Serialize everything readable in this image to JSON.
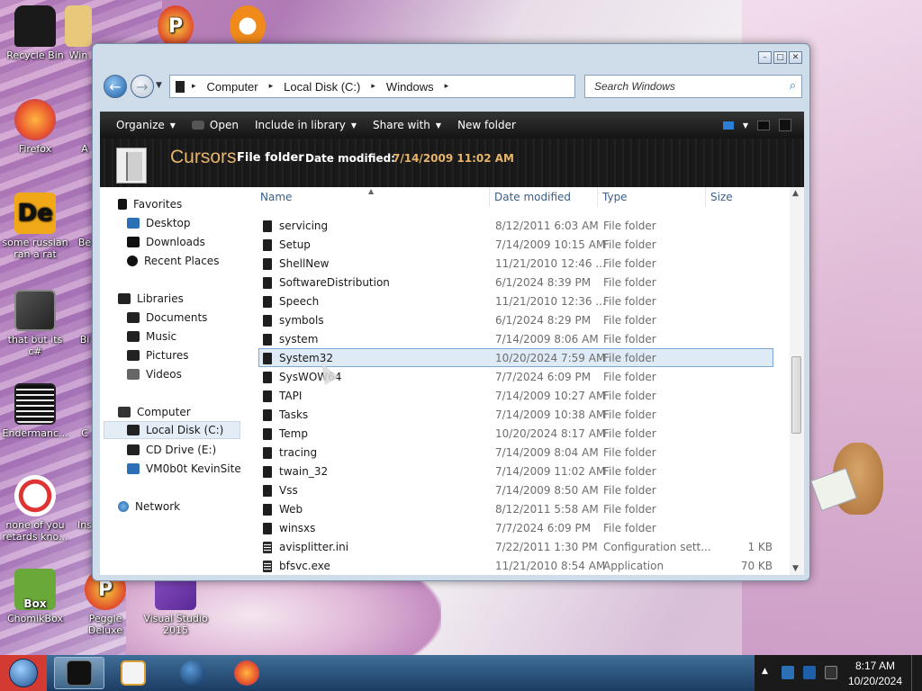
{
  "colors": {
    "toolbar_bg": "#1a1a1a",
    "details_accent": "#e8b46a",
    "selection_bg": "#dfeaf7",
    "start_button": "#d23a32"
  },
  "desktop": {
    "icons": [
      {
        "label": "Recycle Bin",
        "icon": "recycle-bin-icon"
      },
      {
        "label": "Win",
        "icon": "folder-icon"
      },
      {
        "label": "Firefox",
        "icon": "firefox-icon"
      },
      {
        "label": "A",
        "icon": "app-icon"
      },
      {
        "label": "some russian ran a rat",
        "icon": "de-app-icon"
      },
      {
        "label": "Be",
        "icon": "app-icon"
      },
      {
        "label": "that but its c#",
        "icon": "copy-icon"
      },
      {
        "label": "Bi",
        "icon": "app-icon"
      },
      {
        "label": "Endermanc...",
        "icon": "terminal-icon"
      },
      {
        "label": "C",
        "icon": "app-icon"
      },
      {
        "label": "none of you retards kno...",
        "icon": "dragon-icon"
      },
      {
        "label": "Ins",
        "icon": "app-icon"
      },
      {
        "label": "ChomikBox",
        "icon": "chomikbox-icon"
      },
      {
        "label": "Peggle Deluxe",
        "icon": "peggle-icon"
      },
      {
        "label": "Visual Studio 2015",
        "icon": "visual-studio-icon"
      }
    ]
  },
  "window": {
    "nav": {
      "back_icon": "back-arrow-icon",
      "forward_icon": "forward-arrow-icon"
    },
    "breadcrumb": [
      "Computer",
      "Local Disk (C:)",
      "Windows"
    ],
    "search_placeholder": "Search Windows",
    "toolbar": {
      "organize": "Organize",
      "open": "Open",
      "include_in_library": "Include in library",
      "share_with": "Share with",
      "new_folder": "New folder"
    },
    "details": {
      "name": "Cursors",
      "type": "File folder",
      "modified_label": "Date modified:",
      "modified_value": "7/14/2009 11:02 AM"
    },
    "nav_pane": {
      "favorites_header": "Favorites",
      "favorites": [
        "Desktop",
        "Downloads",
        "Recent Places"
      ],
      "libraries_header": "Libraries",
      "libraries": [
        "Documents",
        "Music",
        "Pictures",
        "Videos"
      ],
      "computer_header": "Computer",
      "computer": [
        "Local Disk (C:)",
        "CD Drive (E:)",
        "VM0b0t KevinSite"
      ],
      "network_header": "Network",
      "selected": "Local Disk (C:)"
    },
    "columns": {
      "name": "Name",
      "date": "Date modified",
      "type": "Type",
      "size": "Size"
    },
    "files": [
      {
        "name": "servicing",
        "date": "8/12/2011 6:03 AM",
        "type": "File folder",
        "size": "",
        "kind": "folder"
      },
      {
        "name": "Setup",
        "date": "7/14/2009 10:15 AM",
        "type": "File folder",
        "size": "",
        "kind": "folder"
      },
      {
        "name": "ShellNew",
        "date": "11/21/2010 12:46 ...",
        "type": "File folder",
        "size": "",
        "kind": "folder"
      },
      {
        "name": "SoftwareDistribution",
        "date": "6/1/2024 8:39 PM",
        "type": "File folder",
        "size": "",
        "kind": "folder"
      },
      {
        "name": "Speech",
        "date": "11/21/2010 12:36 ...",
        "type": "File folder",
        "size": "",
        "kind": "folder"
      },
      {
        "name": "symbols",
        "date": "6/1/2024 8:29 PM",
        "type": "File folder",
        "size": "",
        "kind": "folder"
      },
      {
        "name": "system",
        "date": "7/14/2009 8:06 AM",
        "type": "File folder",
        "size": "",
        "kind": "folder"
      },
      {
        "name": "System32",
        "date": "10/20/2024 7:59 AM",
        "type": "File folder",
        "size": "",
        "kind": "folder",
        "selected": true
      },
      {
        "name": "SysWOW64",
        "date": "7/7/2024 6:09 PM",
        "type": "File folder",
        "size": "",
        "kind": "folder"
      },
      {
        "name": "TAPI",
        "date": "7/14/2009 10:27 AM",
        "type": "File folder",
        "size": "",
        "kind": "folder"
      },
      {
        "name": "Tasks",
        "date": "7/14/2009 10:38 AM",
        "type": "File folder",
        "size": "",
        "kind": "folder"
      },
      {
        "name": "Temp",
        "date": "10/20/2024 8:17 AM",
        "type": "File folder",
        "size": "",
        "kind": "folder"
      },
      {
        "name": "tracing",
        "date": "7/14/2009 8:04 AM",
        "type": "File folder",
        "size": "",
        "kind": "folder"
      },
      {
        "name": "twain_32",
        "date": "7/14/2009 11:02 AM",
        "type": "File folder",
        "size": "",
        "kind": "folder"
      },
      {
        "name": "Vss",
        "date": "7/14/2009 8:50 AM",
        "type": "File folder",
        "size": "",
        "kind": "folder"
      },
      {
        "name": "Web",
        "date": "8/12/2011 5:58 AM",
        "type": "File folder",
        "size": "",
        "kind": "folder"
      },
      {
        "name": "winsxs",
        "date": "7/7/2024 6:09 PM",
        "type": "File folder",
        "size": "",
        "kind": "folder"
      },
      {
        "name": "avisplitter.ini",
        "date": "7/22/2011 1:30 PM",
        "type": "Configuration sett...",
        "size": "1 KB",
        "kind": "file"
      },
      {
        "name": "bfsvc.exe",
        "date": "11/21/2010 8:54 AM",
        "type": "Application",
        "size": "70 KB",
        "kind": "file"
      }
    ],
    "scroll_position": 0.55
  },
  "taskbar": {
    "apps": [
      {
        "name": "explorer",
        "icon": "explorer-window-icon",
        "active": true
      },
      {
        "name": "media-player",
        "icon": "media-player-icon",
        "active": false
      },
      {
        "name": "globe",
        "icon": "globe-icon",
        "active": false
      },
      {
        "name": "firefox",
        "icon": "firefox-icon",
        "active": false
      }
    ],
    "clock_time": "8:17 AM",
    "clock_date": "10/20/2024"
  }
}
